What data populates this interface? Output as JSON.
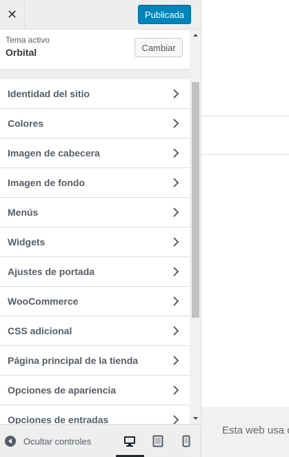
{
  "header": {
    "close_icon": "close-icon",
    "publish_label": "Publicada"
  },
  "theme": {
    "label": "Tema activo",
    "name": "Orbital",
    "change_label": "Cambiar"
  },
  "menu": {
    "items": [
      {
        "label": "Identidad del sitio"
      },
      {
        "label": "Colores"
      },
      {
        "label": "Imagen de cabecera"
      },
      {
        "label": "Imagen de fondo"
      },
      {
        "label": "Menús"
      },
      {
        "label": "Widgets"
      },
      {
        "label": "Ajustes de portada"
      },
      {
        "label": "WooCommerce"
      },
      {
        "label": "CSS adicional"
      },
      {
        "label": "Página principal de la tienda"
      },
      {
        "label": "Opciones de apariencia"
      },
      {
        "label": "Opciones de entradas"
      }
    ]
  },
  "footer": {
    "collapse_label": "Ocultar controles",
    "devices": [
      "desktop-icon",
      "tablet-icon",
      "mobile-icon"
    ],
    "active_device": "desktop"
  },
  "preview": {
    "cookie_text": "Esta web usa c"
  },
  "colors": {
    "accent": "#0085ba",
    "sidebar_bg": "#eeeeee",
    "text": "#555d66"
  }
}
